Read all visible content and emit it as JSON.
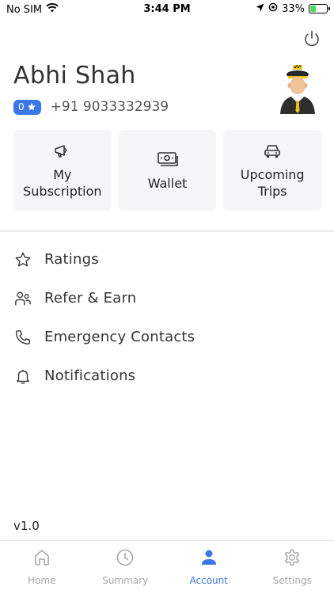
{
  "status_bar": {
    "carrier": "No SIM",
    "time": "3:44 PM",
    "battery": "33%",
    "battery_level": 0.33
  },
  "profile": {
    "name": "Abhi Shah",
    "rating": "0",
    "phone": "+91 9033332939"
  },
  "cards": [
    {
      "label_line1": "My",
      "label_line2": "Subscription",
      "icon": "megaphone-icon"
    },
    {
      "label_line1": "Wallet",
      "label_line2": "",
      "icon": "money-icon"
    },
    {
      "label_line1": "Upcoming",
      "label_line2": "Trips",
      "icon": "car-icon"
    }
  ],
  "menu": [
    {
      "label": "Ratings",
      "icon": "star-icon"
    },
    {
      "label": "Refer & Earn",
      "icon": "users-icon"
    },
    {
      "label": "Emergency Contacts",
      "icon": "phone-icon"
    },
    {
      "label": "Notifications",
      "icon": "bell-icon"
    }
  ],
  "version": "v1.0",
  "tabs": [
    {
      "label": "Home",
      "icon": "home-icon",
      "active": false
    },
    {
      "label": "Summary",
      "icon": "clock-icon",
      "active": false
    },
    {
      "label": "Account",
      "icon": "person-icon",
      "active": true
    },
    {
      "label": "Settings",
      "icon": "gear-icon",
      "active": false
    }
  ],
  "colors": {
    "accent": "#3b78e7",
    "card_bg": "#f5f6f7",
    "inactive_tab": "#a6a6a6",
    "battery_fill": "#4cd964"
  }
}
